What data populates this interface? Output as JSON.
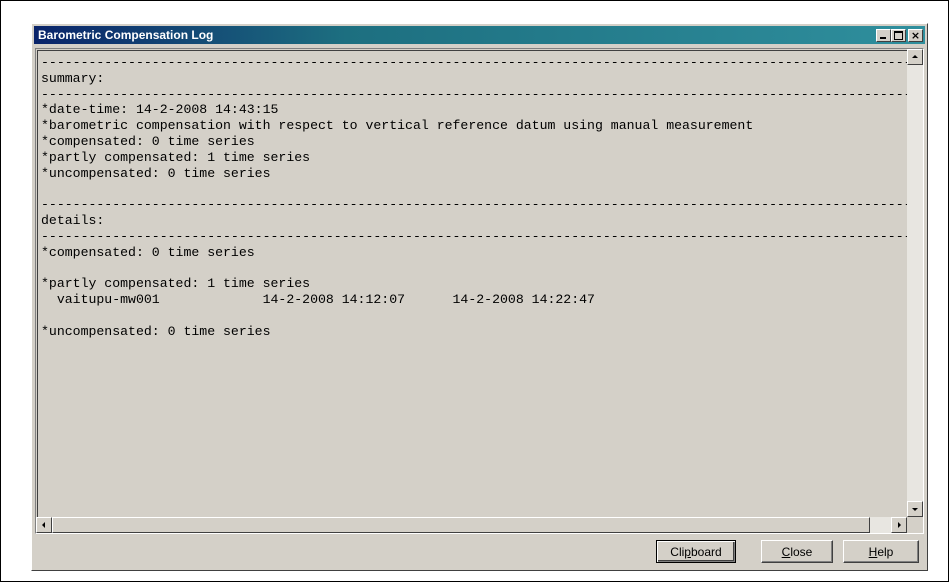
{
  "window": {
    "title": "Barometric Compensation Log"
  },
  "log": {
    "lines": [
      "-----------------------------------------------------------------------------------------------------------------",
      "summary:",
      "-----------------------------------------------------------------------------------------------------------------",
      "*date-time: 14-2-2008 14:43:15",
      "*barometric compensation with respect to vertical reference datum using manual measurement",
      "*compensated: 0 time series",
      "*partly compensated: 1 time series",
      "*uncompensated: 0 time series",
      "",
      "-----------------------------------------------------------------------------------------------------------------",
      "details:",
      "-----------------------------------------------------------------------------------------------------------------",
      "*compensated: 0 time series",
      "",
      "*partly compensated: 1 time series",
      "  vaitupu-mw001             14-2-2008 14:12:07      14-2-2008 14:22:47",
      "",
      "*uncompensated: 0 time series"
    ]
  },
  "buttons": {
    "clipboard": {
      "pre": "Cli",
      "mnemonic": "p",
      "post": "board"
    },
    "close": {
      "pre": "",
      "mnemonic": "C",
      "post": "lose"
    },
    "help": {
      "pre": "",
      "mnemonic": "H",
      "post": "elp"
    }
  },
  "title_buttons": {
    "close_glyph": "×"
  },
  "colors": {
    "titlebar_start": "#0a246a",
    "titlebar_end": "#2f8f9d",
    "window_bg": "#d4d0c8"
  }
}
